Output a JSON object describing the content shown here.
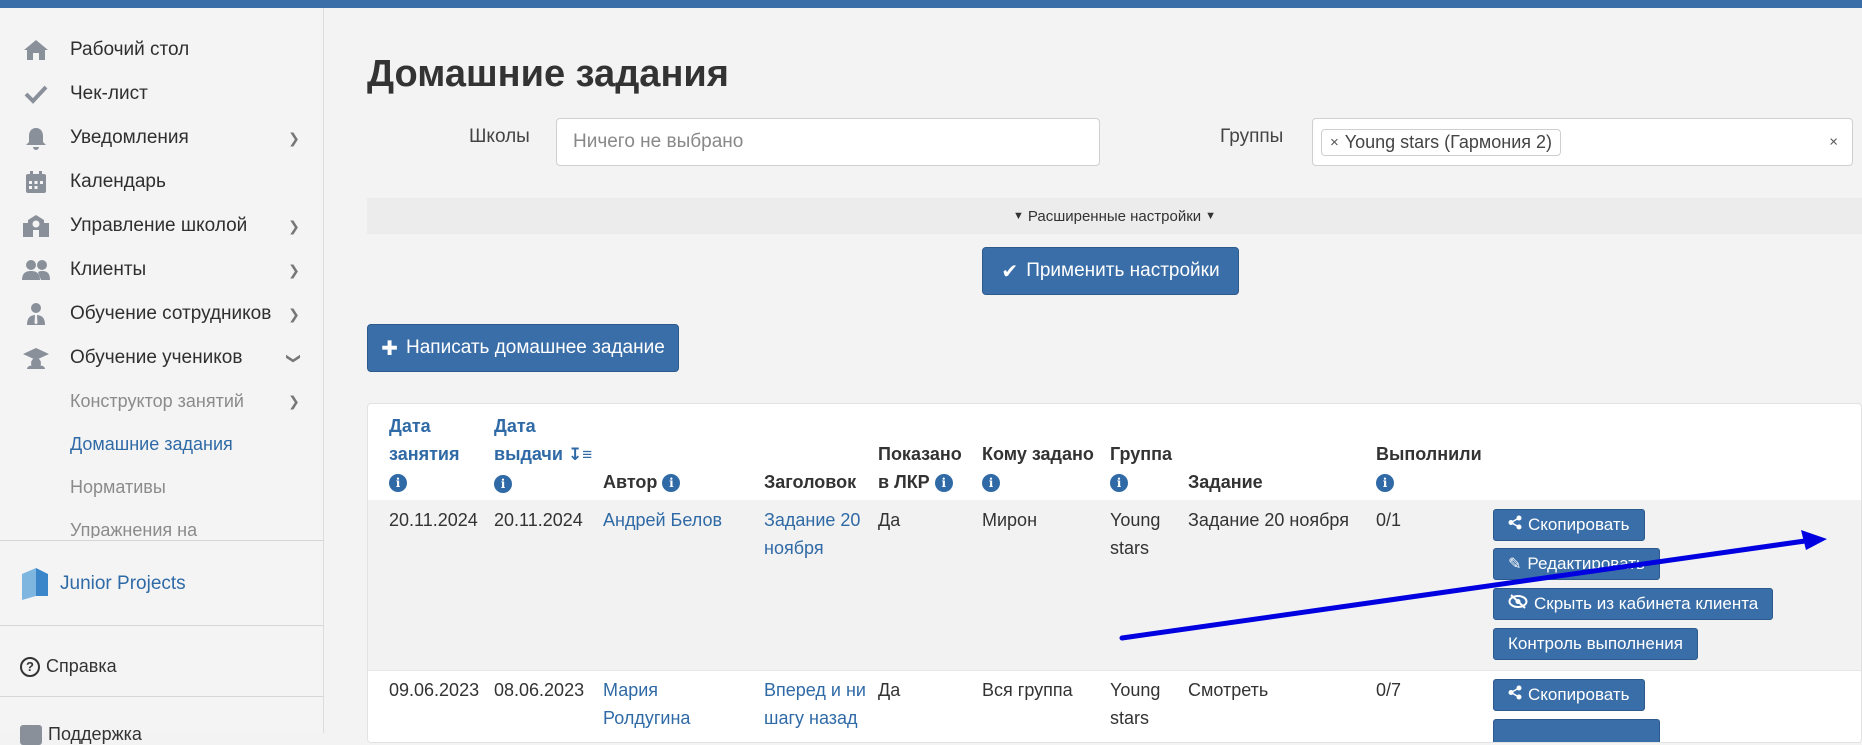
{
  "sidebar": {
    "items": [
      {
        "label": "Рабочий стол",
        "icon": "home-icon",
        "has_chevron": false
      },
      {
        "label": "Чек-лист",
        "icon": "check-icon",
        "has_chevron": false
      },
      {
        "label": "Уведомления",
        "icon": "bell-icon",
        "has_chevron": true
      },
      {
        "label": "Календарь",
        "icon": "calendar-icon",
        "has_chevron": false
      },
      {
        "label": "Управление школой",
        "icon": "school-icon",
        "has_chevron": true
      },
      {
        "label": "Клиенты",
        "icon": "users-icon",
        "has_chevron": true
      },
      {
        "label": "Обучение сотрудников",
        "icon": "employee-icon",
        "has_chevron": true
      },
      {
        "label": "Обучение учеников",
        "icon": "graduation-cap-icon",
        "has_chevron": true
      }
    ],
    "subitems": [
      {
        "label": "Конструктор занятий",
        "has_chevron": true
      },
      {
        "label": "Домашние задания",
        "active": true
      },
      {
        "label": "Нормативы"
      },
      {
        "label": "Упражнения на"
      }
    ],
    "brand": "Junior Projects",
    "help": "Справка",
    "support": "Поддержка"
  },
  "page": {
    "title": "Домашние задания",
    "schools_label": "Школы",
    "schools_placeholder": "Ничего не выбрано",
    "groups_label": "Группы",
    "groups_tag": "Young stars (Гармония 2)",
    "advanced": "Расширенные настройки",
    "apply_button": "Применить настройки",
    "new_button": "Написать домашнее задание"
  },
  "table": {
    "headers": {
      "lesson_date": [
        "Дата",
        "занятия"
      ],
      "issue_date": [
        "Дата",
        "выдачи"
      ],
      "author": "Автор",
      "title": "Заголовок",
      "shown": [
        "Показано",
        "в ЛКР"
      ],
      "assigned": "Кому задано",
      "group": "Группа",
      "task": "Задание",
      "done": "Выполнили"
    },
    "rows": [
      {
        "lesson_date": "20.11.2024",
        "issue_date": "20.11.2024",
        "author": [
          "Андрей Белов"
        ],
        "title": [
          "Задание 20",
          "ноября"
        ],
        "shown": "Да",
        "assigned": "Мирон",
        "group": [
          "Young",
          "stars"
        ],
        "task": "Задание 20 ноября",
        "done": "0/1",
        "actions": [
          "Скопировать",
          "Редактировать",
          "Скрыть из кабинета клиента",
          "Контроль выполнения"
        ]
      },
      {
        "lesson_date": "09.06.2023",
        "issue_date": "08.06.2023",
        "author": [
          "Мария",
          "Ролдугина"
        ],
        "title": [
          "Вперед и ни",
          "шагу назад"
        ],
        "shown": "Да",
        "assigned": "Вся группа",
        "group": [
          "Young",
          "stars"
        ],
        "task": "Смотреть",
        "done": "0/7",
        "actions": [
          "Скопировать"
        ]
      }
    ]
  },
  "colors": {
    "accent": "#3a6ea8",
    "link": "#2f6aa6",
    "annotation_arrow": "#0000e0"
  }
}
